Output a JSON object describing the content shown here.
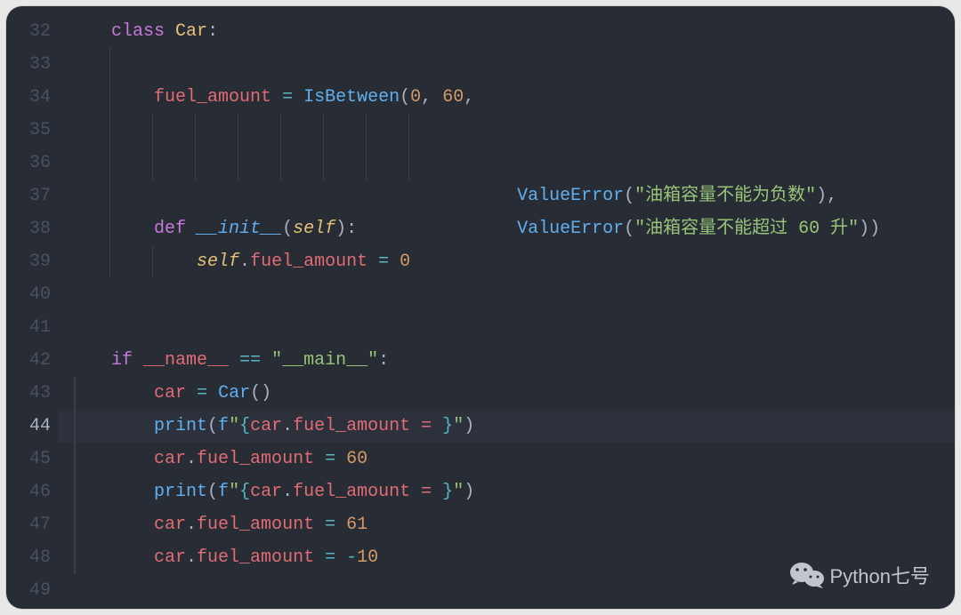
{
  "editor": {
    "line_start": 32,
    "line_end": 49,
    "active_line": 44
  },
  "ln": {
    "32": "32",
    "33": "33",
    "34": "34",
    "35": "35",
    "36": "36",
    "37": "37",
    "38": "38",
    "39": "39",
    "40": "40",
    "41": "41",
    "42": "42",
    "43": "43",
    "44": "44",
    "45": "45",
    "46": "46",
    "47": "47",
    "48": "48",
    "49": "49"
  },
  "code": {
    "l32": {
      "kw_class": "class",
      "name": "Car",
      "colon": ":"
    },
    "l34": {
      "attr": "fuel_amount",
      "assign": "=",
      "ctor": "IsBetween",
      "lp": "(",
      "a": "0",
      "c1": ",",
      "sp": " ",
      "b": "60",
      "c2": ","
    },
    "l35": {
      "ctor": "ValueError",
      "lp": "(",
      "s": "\"油箱容量不能为负数\"",
      "rp": ")",
      "c": ","
    },
    "l36": {
      "ctor": "ValueError",
      "lp": "(",
      "s": "\"油箱容量不能超过 60 升\"",
      "rp": ")",
      "rp2": ")"
    },
    "l38": {
      "kw_def": "def",
      "name": "__init__",
      "lp": "(",
      "self": "self",
      "rp": ")",
      "colon": ":"
    },
    "l39": {
      "self": "self",
      "dot": ".",
      "attr": "fuel_amount",
      "assign": "=",
      "val": "0"
    },
    "l42": {
      "kw_if": "if",
      "dunder": "__name__",
      "eq": "==",
      "s": "\"__main__\"",
      "colon": ":"
    },
    "l43": {
      "var": "car",
      "assign": "=",
      "ctor": "Car",
      "lp": "(",
      "rp": ")"
    },
    "l44": {
      "fn": "print",
      "lp": "(",
      "fpfx": "f",
      "q1": "\"",
      "lb": "{",
      "expr_obj": "car",
      "dot": ".",
      "expr_attr": "fuel_amount",
      "expr_rest": " = ",
      "rb": "}",
      "q2": "\"",
      "rp": ")"
    },
    "l45": {
      "obj": "car",
      "dot": ".",
      "attr": "fuel_amount",
      "assign": "=",
      "val": "60"
    },
    "l46": {
      "fn": "print",
      "lp": "(",
      "fpfx": "f",
      "q1": "\"",
      "lb": "{",
      "expr_obj": "car",
      "dot": ".",
      "expr_attr": "fuel_amount",
      "expr_rest": " = ",
      "rb": "}",
      "q2": "\"",
      "rp": ")"
    },
    "l47": {
      "obj": "car",
      "dot": ".",
      "attr": "fuel_amount",
      "assign": "=",
      "val": "61"
    },
    "l48": {
      "obj": "car",
      "dot": ".",
      "attr": "fuel_amount",
      "assign": "=",
      "neg": "-",
      "val": "10"
    }
  },
  "watermark": {
    "label": "Python七号"
  }
}
